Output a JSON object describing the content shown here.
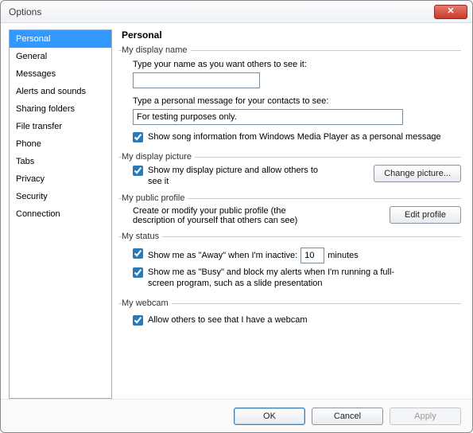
{
  "window": {
    "title": "Options"
  },
  "sidebar": {
    "items": [
      "Personal",
      "General",
      "Messages",
      "Alerts and sounds",
      "Sharing folders",
      "File transfer",
      "Phone",
      "Tabs",
      "Privacy",
      "Security",
      "Connection"
    ],
    "selected_index": 0
  },
  "page": {
    "title": "Personal",
    "display_name": {
      "legend": "My display name",
      "prompt": "Type your name as you want others to see it:",
      "value": "",
      "personal_msg_prompt": "Type a personal message for your contacts to see:",
      "personal_msg_value": "For testing purposes only.",
      "song_checkbox": "Show song information from Windows Media Player as a personal message",
      "song_checked": true
    },
    "display_picture": {
      "legend": "My display picture",
      "checkbox": "Show my display picture and allow others to see it",
      "checked": true,
      "button": "Change picture..."
    },
    "public_profile": {
      "legend": "My public profile",
      "desc": "Create or modify your public profile (the description of yourself that others can see)",
      "button": "Edit profile"
    },
    "status": {
      "legend": "My status",
      "away_prefix": "Show me as \"Away\" when I'm inactive:",
      "away_minutes": "10",
      "away_suffix": "minutes",
      "away_checked": true,
      "busy_text": "Show me as \"Busy\" and block my alerts when I'm running a full-screen program, such as a slide presentation",
      "busy_checked": true
    },
    "webcam": {
      "legend": "My webcam",
      "checkbox": "Allow others to see that I have a webcam",
      "checked": true
    }
  },
  "buttons": {
    "ok": "OK",
    "cancel": "Cancel",
    "apply": "Apply"
  }
}
